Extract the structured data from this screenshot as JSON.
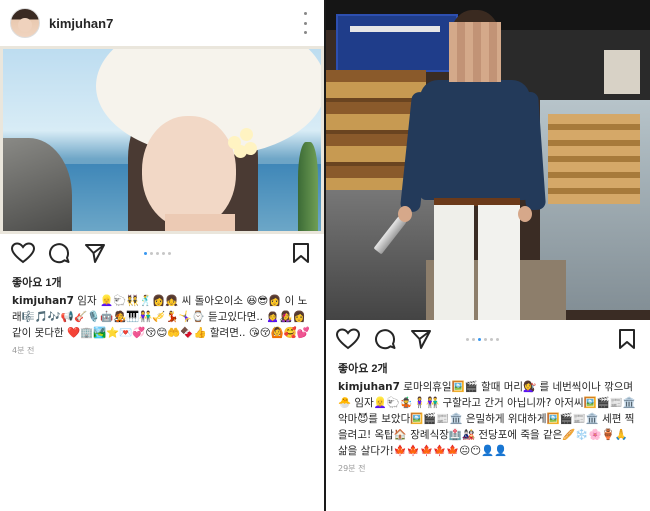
{
  "posts": [
    {
      "username": "kimjuhan7",
      "likes": "좋아요 1개",
      "caption_user": "kimjuhan7",
      "caption_text": " 임자 👱‍♀️🐑👯🕺👩👧 씨 돌아오이소 😆😎👩 이 노래🎼🎵🎶📢🎸🎙️🤖🧑‍🎤🎹👫🎺💃🤸‍♀️⌚ 듣고있다면.. 🙍‍♀️👩‍🎤👩 같이 못다한 ❤️🏢🏞️⭐💌💞😚😊🤲🍫👍 할려면.. 😘😚🙆🥰💕",
      "timestamp": "4분 전",
      "carousel_dots": 5,
      "active_dot": 0
    },
    {
      "username": "",
      "likes": "좋아요 2개",
      "caption_user": "kimjuhan7",
      "caption_text": " 로마의휴일🖼️🎬 할때 머리💇‍♀️ 를 네번씩이나 깎으며🐣 임자👱‍♀️🐑🤹🧍‍♀️👫 구할라고 간거 아닙니까? 아저씨🖼️🎬📰🏛️ 악마😈를 보았다🖼️🎬📰🏛️ 은밀하게 위대하게🖼️🎬📰🏛️ 세편 찍을려고! 옥탑🏠 장례식장🏥🎎 전당포에 죽을 같은🥖❄️🌸🏺🙏 삶을 살다가!🍁🍁🍁🍁🍁😐😶👤👤",
      "timestamp": "29분 전",
      "carousel_dots": 6,
      "active_dot": 2
    }
  ]
}
